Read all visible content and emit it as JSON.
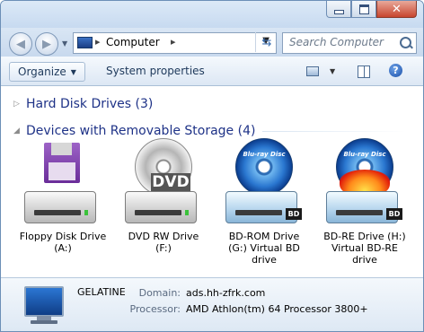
{
  "window": {
    "caption_buttons": [
      "minimize",
      "maximize",
      "close"
    ]
  },
  "address": {
    "crumb": "Computer",
    "search_placeholder": "Search Computer"
  },
  "toolbar": {
    "organize": "Organize",
    "system_properties": "System properties"
  },
  "groups": [
    {
      "title": "Hard Disk Drives (3)",
      "expanded": false
    },
    {
      "title": "Devices with Removable Storage (4)",
      "expanded": true
    }
  ],
  "devices": [
    {
      "line1": "Floppy Disk Drive",
      "line2": "(A:)",
      "line3": "",
      "icon": "floppy-drive-icon"
    },
    {
      "line1": "DVD RW Drive",
      "line2": "(F:)",
      "line3": "",
      "icon": "dvd-drive-icon",
      "disc_text": "DVD"
    },
    {
      "line1": "BD-ROM Drive",
      "line2": "(G:) Virtual BD",
      "line3": "drive",
      "icon": "bdrom-drive-icon",
      "badge": "BD"
    },
    {
      "line1": "BD-RE Drive (H:)",
      "line2": "Virtual BD-RE",
      "line3": "drive",
      "icon": "bdre-drive-icon",
      "badge": "BD"
    }
  ],
  "details": {
    "name": "GELATINE",
    "domain_label": "Domain:",
    "domain": "ads.hh-zfrk.com",
    "processor_label": "Processor:",
    "processor": "AMD Athlon(tm) 64 Processor 3800+"
  }
}
